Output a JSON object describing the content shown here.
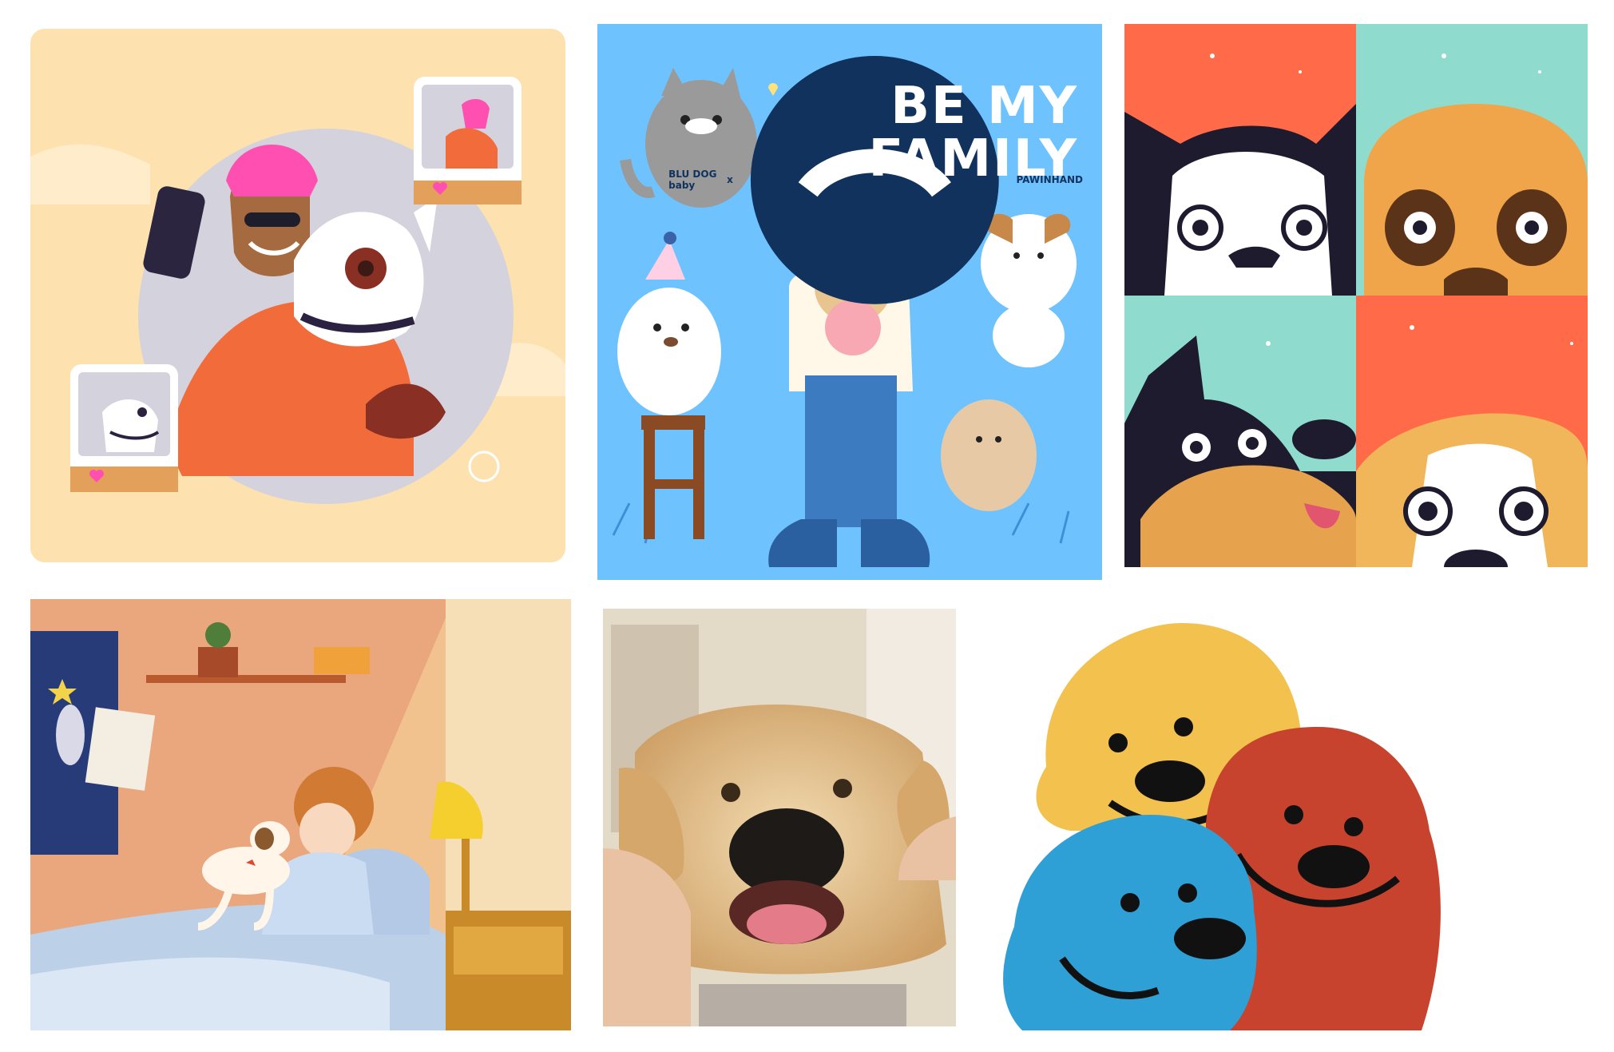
{
  "tiles": {
    "selfie": {
      "label": ""
    },
    "poster": {
      "brand_left": "BLU DOG baby",
      "brand_sep": "x",
      "brand_right": "PAWINHAND",
      "headline_line1": "BE MY",
      "headline_line2": "FAMILY"
    },
    "quad": {},
    "bedroom": {},
    "puppy_photo": {},
    "blobs": {}
  },
  "colors": {
    "selfie_bg": "#fde2b0",
    "poster_bg": "#6ec3ff",
    "quad_red": "#ff6a48",
    "quad_teal": "#8fdccf",
    "blob_yellow": "#f3c24e",
    "blob_red": "#c8432d",
    "blob_blue": "#2ea0d6"
  }
}
